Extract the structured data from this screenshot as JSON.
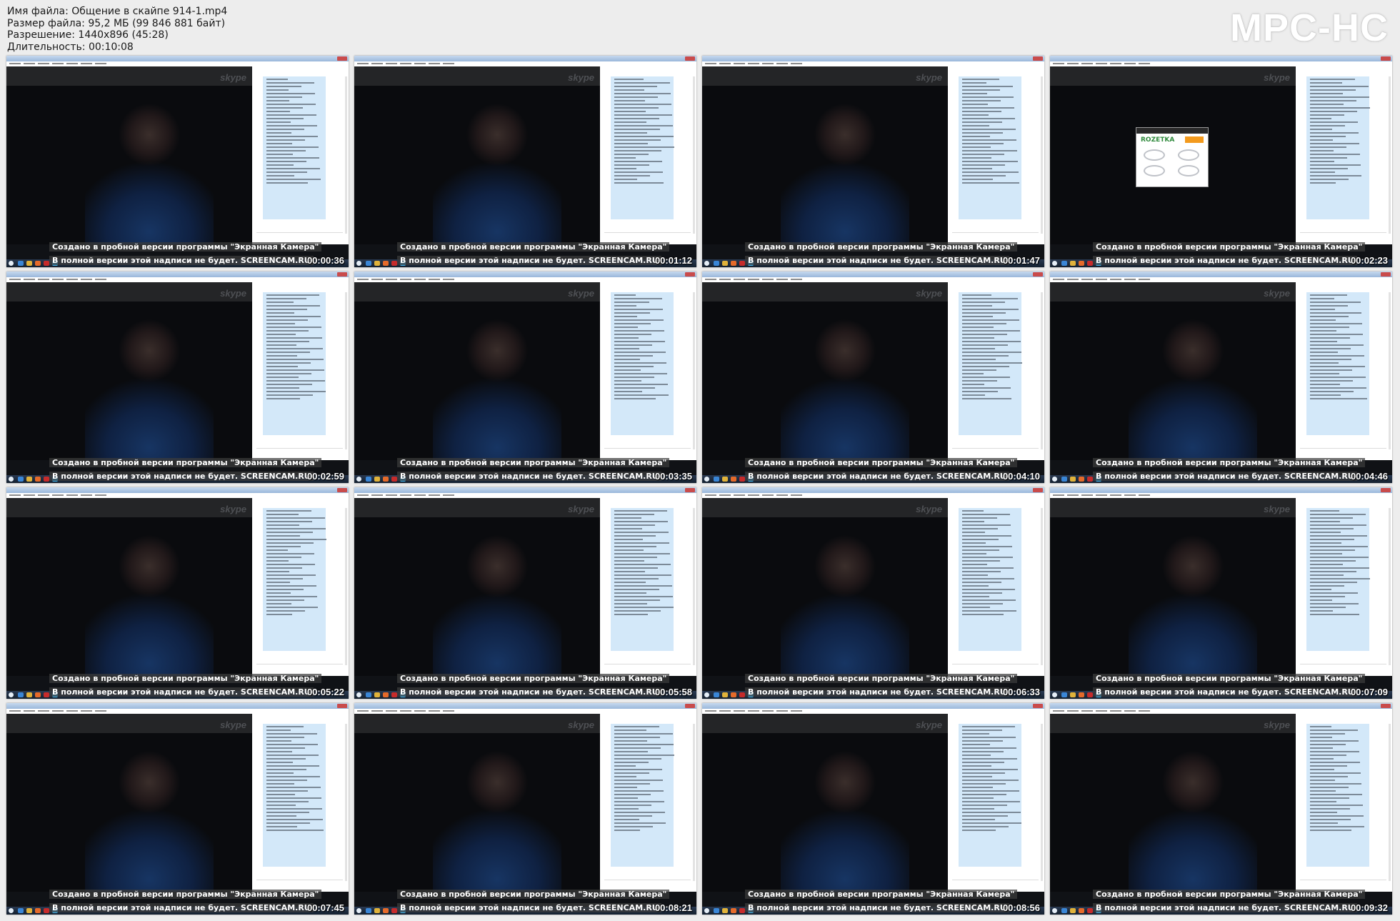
{
  "header": {
    "file_name": "Имя файла: Общение в скайпе 914-1.mp4",
    "file_size": "Размер файла: 95,2 МБ (99 846 881 байт)",
    "resolution": "Разрешение: 1440x896 (45:28)",
    "duration": "Длительность: 00:10:08"
  },
  "brand": "MPC-HC",
  "skype_logo": "skype",
  "watermark": {
    "line1": "Создано в пробной версии программы \"Экранная Камера\"",
    "line2": "В полной версии этой надписи не будет. SCREENCAM.RU"
  },
  "ad": {
    "logo": "ROZETKA"
  },
  "thumbnails": [
    {
      "time": "00:00:36"
    },
    {
      "time": "00:01:12"
    },
    {
      "time": "00:01:47"
    },
    {
      "time": "00:02:23"
    },
    {
      "time": "00:02:59"
    },
    {
      "time": "00:03:35"
    },
    {
      "time": "00:04:10"
    },
    {
      "time": "00:04:46"
    },
    {
      "time": "00:05:22"
    },
    {
      "time": "00:05:58"
    },
    {
      "time": "00:06:33"
    },
    {
      "time": "00:07:09"
    },
    {
      "time": "00:07:45"
    },
    {
      "time": "00:08:21"
    },
    {
      "time": "00:08:56"
    },
    {
      "time": "00:09:32"
    }
  ]
}
